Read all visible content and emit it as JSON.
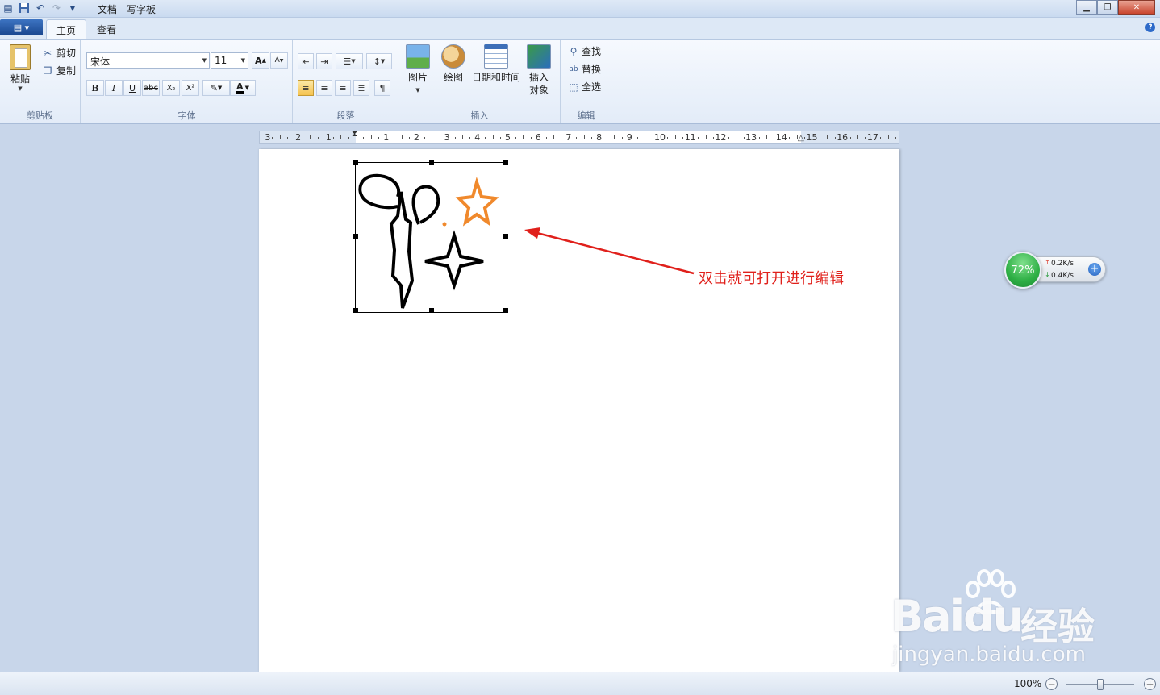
{
  "window": {
    "title": "文档 - 写字板"
  },
  "tabs": {
    "home": "主页",
    "view": "查看"
  },
  "clipboard": {
    "paste": "粘贴",
    "cut": "剪切",
    "copy": "复制",
    "group": "剪贴板"
  },
  "font": {
    "family": "宋体",
    "size": "11",
    "grow": "A",
    "shrink": "A",
    "bold": "B",
    "italic": "I",
    "underline": "U",
    "strike": "abc",
    "subscript": "X₂",
    "superscript": "X²",
    "color_letter": "A",
    "group": "字体"
  },
  "paragraph": {
    "group": "段落"
  },
  "insert": {
    "picture": "图片",
    "paint": "绘图",
    "datetime": "日期和时间",
    "object_line1": "插入",
    "object_line2": "对象",
    "group": "插入"
  },
  "edit": {
    "find": "查找",
    "replace": "替换",
    "select_all": "全选",
    "group": "编辑"
  },
  "ruler": {
    "labels": [
      "3",
      "2",
      "1",
      "1",
      "2",
      "3",
      "4",
      "5",
      "6",
      "7",
      "8",
      "9",
      "10",
      "11",
      "12",
      "13",
      "14",
      "15",
      "16",
      "17"
    ]
  },
  "annotation": "双击就可打开进行编辑",
  "network": {
    "percent": "72%",
    "upload": "0.2K/s",
    "download": "0.4K/s",
    "up_arrow": "↑",
    "down_arrow": "↓",
    "plus": "+"
  },
  "watermark": {
    "logo": "Baidu",
    "text": "经验",
    "url": "jingyan.baidu.com"
  },
  "status": {
    "zoom": "100%",
    "zoom_out": "−",
    "zoom_in": "+"
  },
  "colors": {
    "accent_red": "#e0201b",
    "star_orange": "#f0892c",
    "net_green": "#2eaf45"
  },
  "icons": {
    "save": "save-icon",
    "undo": "undo-icon",
    "redo": "redo-icon",
    "cut": "scissors-icon",
    "copy": "copy-icon",
    "find": "binoculars-icon",
    "replace": "replace-icon",
    "select_all": "select-all-icon"
  }
}
